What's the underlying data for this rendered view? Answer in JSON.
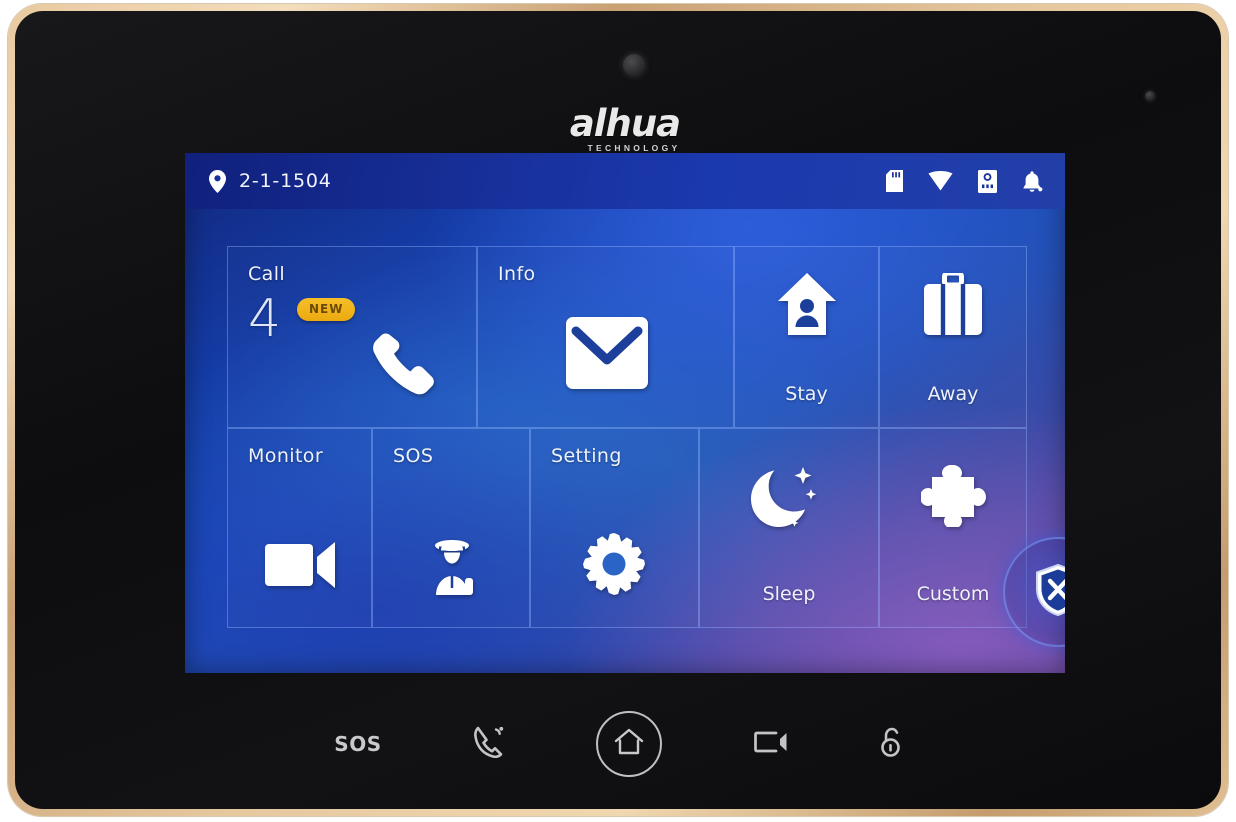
{
  "device": {
    "brand": "alhua",
    "brand_sub": "TECHNOLOGY",
    "bezel_color": "#d9b versus",
    "frame_color": "#dcb98c",
    "body_color": "#101012"
  },
  "screen": {
    "status_bar": {
      "location_icon": "location-pin-icon",
      "location": "2-1-1504",
      "icons": [
        {
          "name": "sd-card-icon",
          "label": "SD Card"
        },
        {
          "name": "wifi-icon",
          "label": "Wi-Fi"
        },
        {
          "name": "door-station-icon",
          "label": "Door Station"
        },
        {
          "name": "bell-icon",
          "label": "Alarm Bell"
        }
      ]
    },
    "tiles": [
      {
        "id": "call",
        "label": "Call",
        "icon": "phone-icon",
        "count": "4",
        "badge": "NEW",
        "label_pos": "top"
      },
      {
        "id": "info",
        "label": "Info",
        "icon": "envelope-icon",
        "label_pos": "top"
      },
      {
        "id": "stay",
        "label": "Stay",
        "icon": "house-person-icon",
        "label_pos": "bottom"
      },
      {
        "id": "away",
        "label": "Away",
        "icon": "briefcase-icon",
        "label_pos": "bottom"
      },
      {
        "id": "monitor",
        "label": "Monitor",
        "icon": "video-camera-icon",
        "label_pos": "top"
      },
      {
        "id": "sos",
        "label": "SOS",
        "icon": "security-guard-icon",
        "label_pos": "top"
      },
      {
        "id": "setting",
        "label": "Setting",
        "icon": "gear-icon",
        "label_pos": "top"
      },
      {
        "id": "sleep",
        "label": "Sleep",
        "icon": "moon-stars-icon",
        "label_pos": "bottom"
      },
      {
        "id": "custom",
        "label": "Custom",
        "icon": "puzzle-piece-icon",
        "label_pos": "bottom"
      }
    ],
    "center_button": {
      "name": "disarm-shield-button",
      "icon": "shield-x-icon"
    },
    "colors": {
      "accent_blue": "#1b4fc0",
      "deep_blue": "#12287e",
      "purple": "#5f459c",
      "status_bar": "#17309a",
      "badge_yellow": "#eba90f",
      "tile_border": "#96b9ff"
    }
  },
  "hardware_buttons": [
    {
      "id": "sos",
      "label": "SOS",
      "icon": "sos-text-icon"
    },
    {
      "id": "call",
      "label": "",
      "icon": "phone-call-icon"
    },
    {
      "id": "home",
      "label": "",
      "icon": "home-icon"
    },
    {
      "id": "monitor",
      "label": "",
      "icon": "video-camera-icon"
    },
    {
      "id": "unlock",
      "label": "",
      "icon": "unlock-icon"
    }
  ]
}
